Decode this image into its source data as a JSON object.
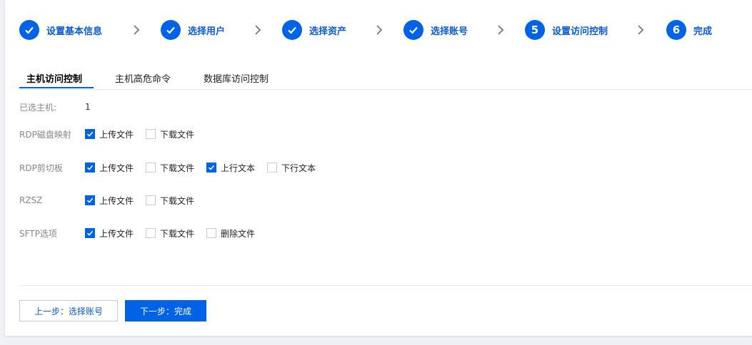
{
  "steps": [
    {
      "label": "设置基本信息",
      "state": "done"
    },
    {
      "label": "选择用户",
      "state": "done"
    },
    {
      "label": "选择资产",
      "state": "done"
    },
    {
      "label": "选择账号",
      "state": "done"
    },
    {
      "label": "设置访问控制",
      "state": "current",
      "number": "5"
    },
    {
      "label": "完成",
      "state": "pending",
      "number": "6"
    }
  ],
  "tabs": [
    {
      "label": "主机访问控制",
      "active": true
    },
    {
      "label": "主机高危命令",
      "active": false
    },
    {
      "label": "数据库访问控制",
      "active": false
    }
  ],
  "form": {
    "selected_hosts": {
      "label": "已选主机:",
      "value": "1"
    },
    "rdp_disk": {
      "label": "RDP磁盘映射",
      "options": [
        {
          "label": "上传文件",
          "checked": true
        },
        {
          "label": "下载文件",
          "checked": false
        }
      ]
    },
    "rdp_clipboard": {
      "label": "RDP剪切板",
      "options": [
        {
          "label": "上传文件",
          "checked": true
        },
        {
          "label": "下载文件",
          "checked": false
        },
        {
          "label": "上行文本",
          "checked": true
        },
        {
          "label": "下行文本",
          "checked": false
        }
      ]
    },
    "rzsz": {
      "label": "RZSZ",
      "options": [
        {
          "label": "上传文件",
          "checked": true
        },
        {
          "label": "下载文件",
          "checked": false
        }
      ]
    },
    "sftp": {
      "label": "SFTP选项",
      "options": [
        {
          "label": "上传文件",
          "checked": true
        },
        {
          "label": "下载文件",
          "checked": false
        },
        {
          "label": "删除文件",
          "checked": false
        }
      ]
    }
  },
  "buttons": {
    "prev": "上一步：选择账号",
    "next": "下一步：完成"
  },
  "colors": {
    "accent": "#0062e6",
    "step_label": "#0b5bd6",
    "muted_label": "#888888"
  }
}
